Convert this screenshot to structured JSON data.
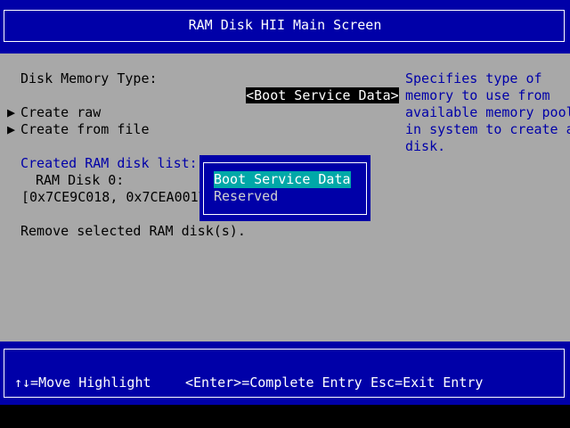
{
  "header": {
    "title": "RAM Disk HII Main Screen"
  },
  "form": {
    "memory_type_label": "Disk Memory Type:",
    "memory_type_value": "<Boot Service Data>",
    "create_raw": "Create raw",
    "create_from_file": "Create from file",
    "created_list_label": "Created RAM disk list:",
    "ram_disk_0": "RAM Disk 0:",
    "ram_disk_0_range": "[0x7CE9C018, 0x7CEA0017]",
    "remove_selected": "Remove selected RAM disk(s)."
  },
  "help": {
    "lines": [
      "Specifies type of",
      "memory to use from",
      "available memory pool",
      "in system to create a",
      "disk."
    ]
  },
  "popup": {
    "options": [
      "Boot Service Data",
      "Reserved"
    ],
    "selected": "Boot Service Data"
  },
  "footer": {
    "move_hint": "↑↓=Move Highlight",
    "enter_hint": "<Enter>=Complete Entry",
    "esc_hint": "Esc=Exit Entry"
  },
  "colors": {
    "title_background": "#0000a8",
    "body_background": "#a8a8a8",
    "highlight_background": "#00a8a8",
    "help_text": "#0000a8"
  },
  "icons": {
    "submenu_marker": "▶"
  }
}
